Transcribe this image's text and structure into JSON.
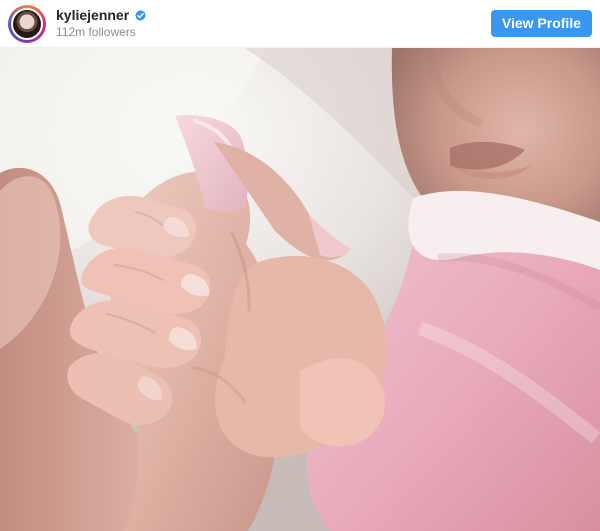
{
  "profile": {
    "username": "kyliejenner",
    "followers": "112m followers",
    "verified_icon": "verified-badge-icon",
    "avatar_icon": "profile-avatar"
  },
  "actions": {
    "view_profile_label": "View Profile"
  },
  "post": {
    "image_icon": "post-photo"
  },
  "colors": {
    "accent": "#3897f0",
    "username_text": "#262626",
    "secondary_text": "#8e8e8e",
    "divider": "#efefef"
  }
}
